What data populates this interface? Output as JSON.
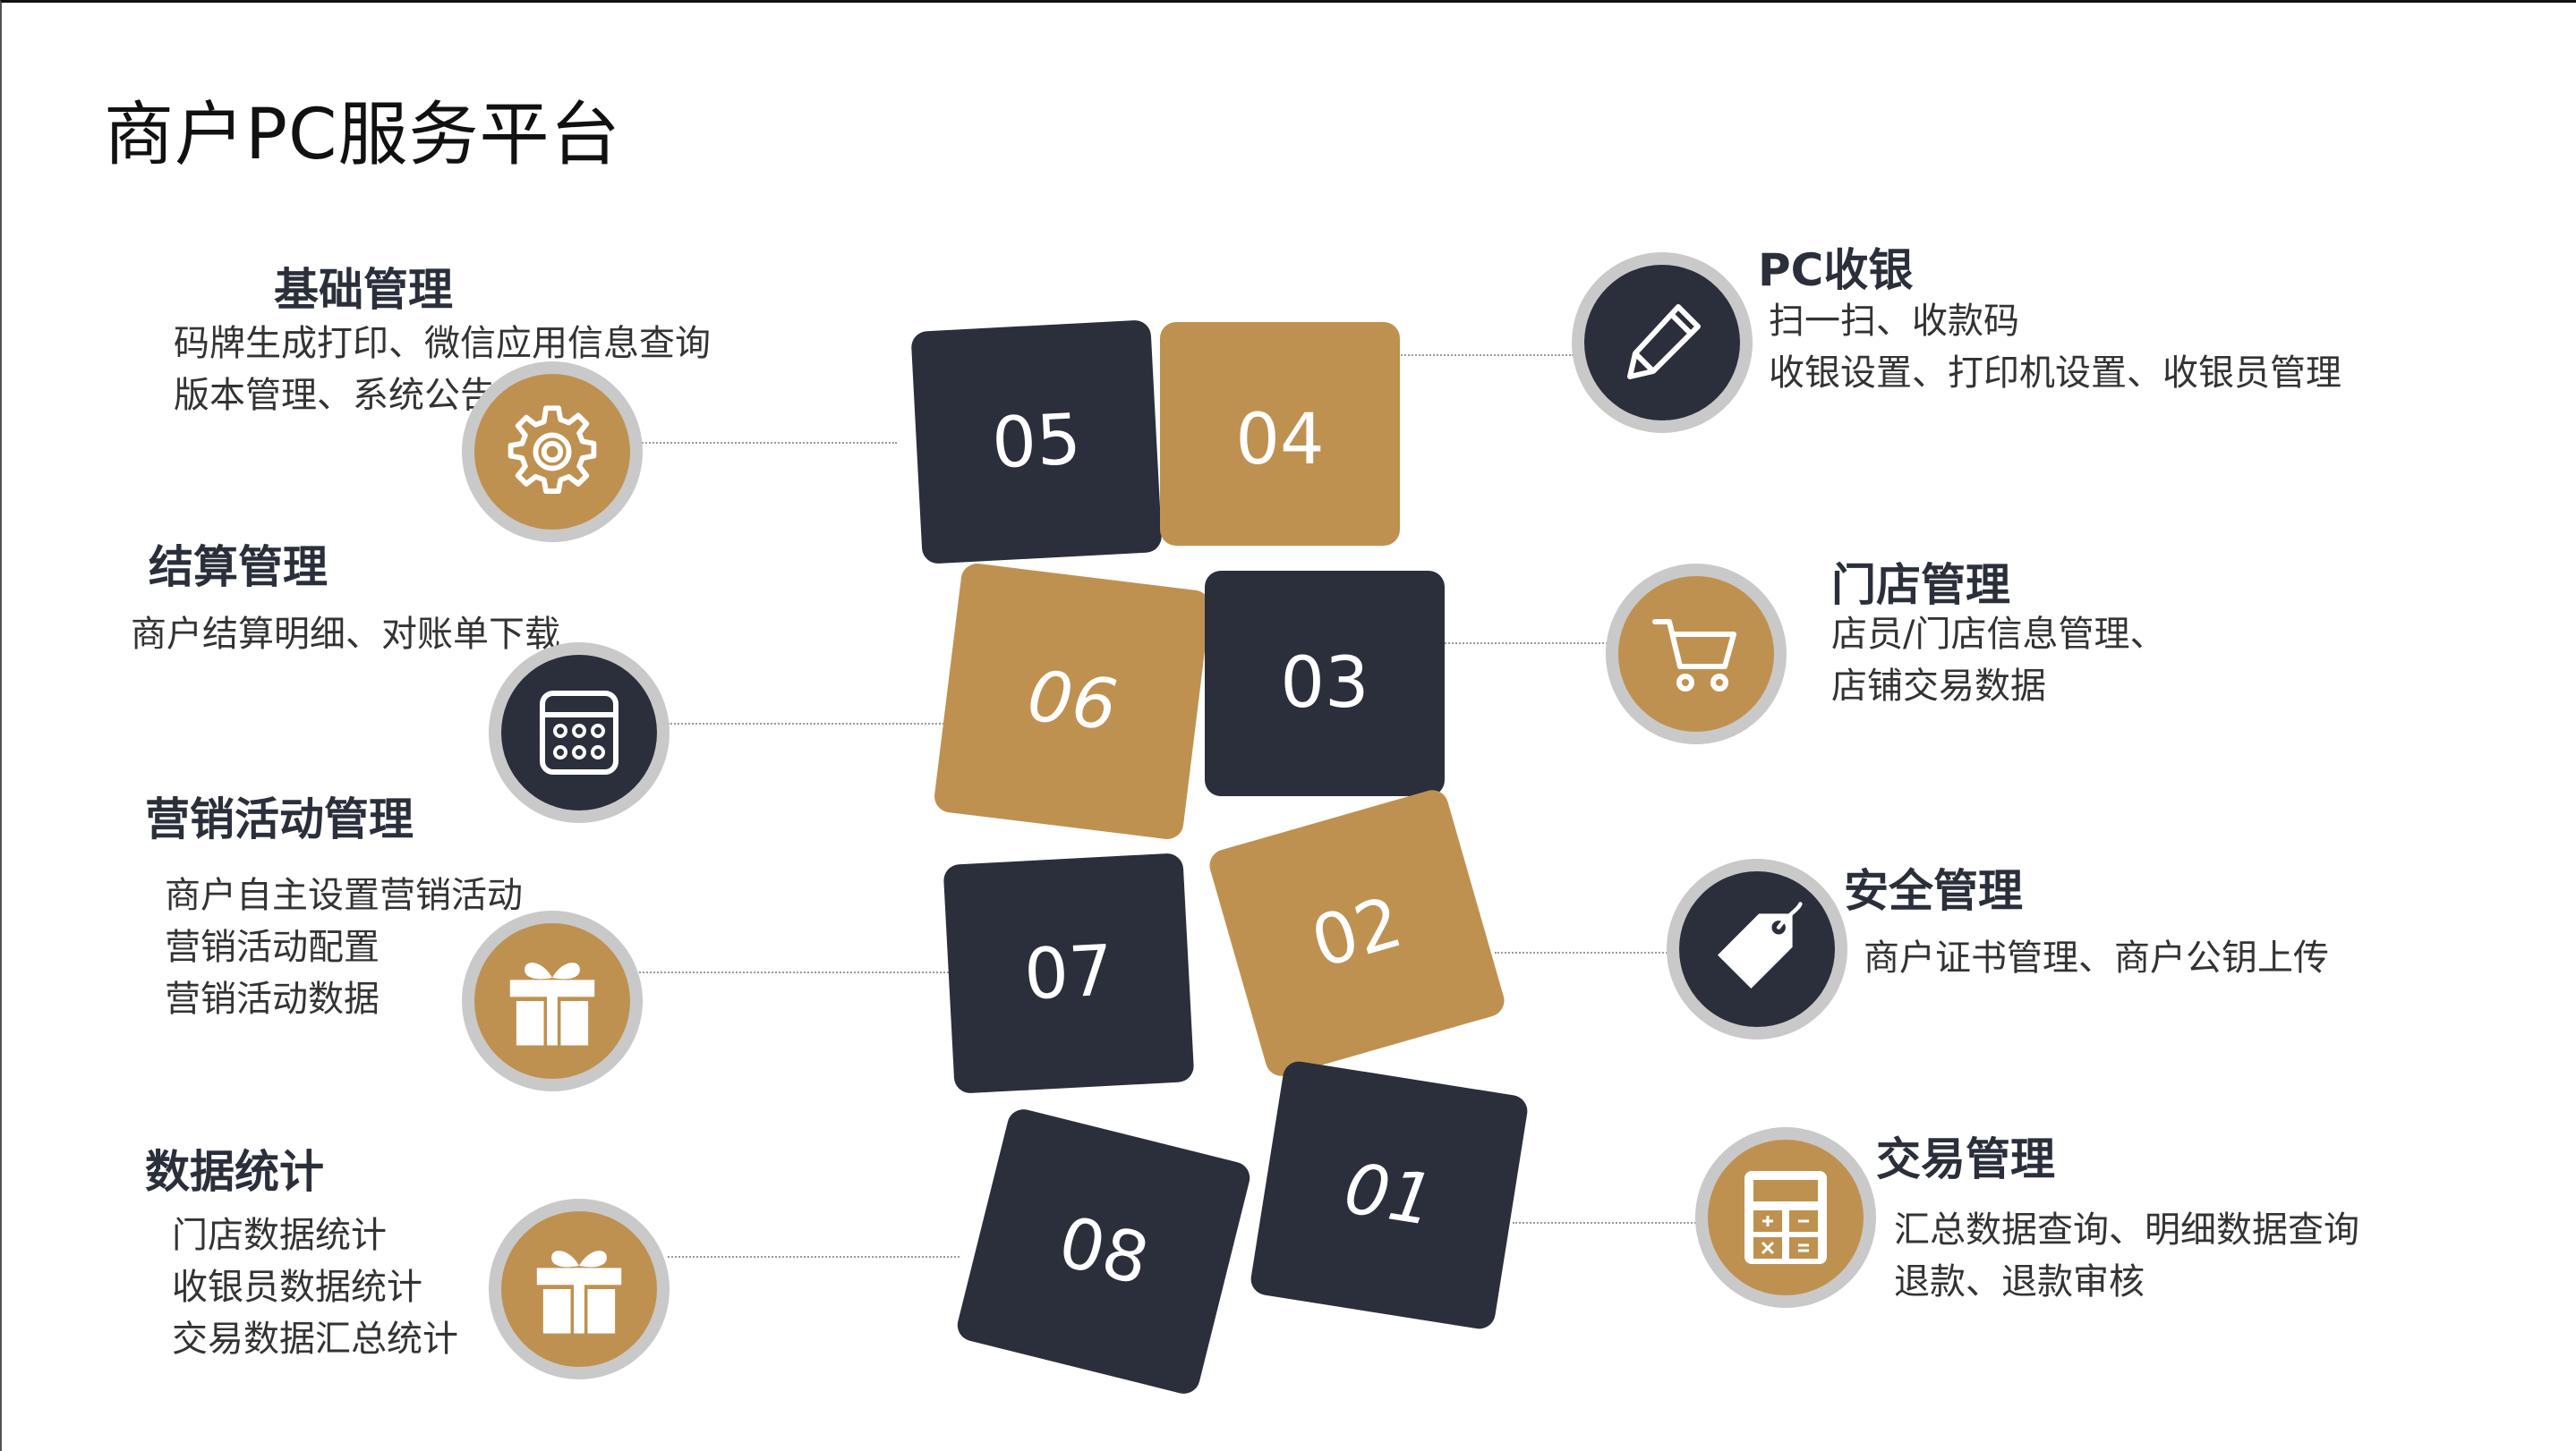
{
  "title": "商户PC服务平台",
  "colors": {
    "gold": "#bf9150",
    "navy": "#2a2f3b",
    "ring": "#c9c9c9"
  },
  "tiles": [
    "01",
    "02",
    "03",
    "04",
    "05",
    "06",
    "07",
    "08"
  ],
  "sections": {
    "jichu": {
      "heading": "基础管理",
      "lines": [
        "码牌生成打印、微信应用信息查询",
        "版本管理、系统公告"
      ],
      "icon": "gear-icon"
    },
    "jiesuan": {
      "heading": "结算管理",
      "lines": [
        "商户结算明细、对账单下载"
      ],
      "icon": "calculator-icon"
    },
    "yingxiao": {
      "heading": "营销活动管理",
      "lines": [
        "商户自主设置营销活动",
        "营销活动配置",
        "营销活动数据"
      ],
      "icon": "gift-icon"
    },
    "shuju": {
      "heading": "数据统计",
      "lines": [
        "门店数据统计",
        "收银员数据统计",
        "交易数据汇总统计"
      ],
      "icon": "gift-icon"
    },
    "pc": {
      "heading": "PC收银",
      "lines": [
        "扫一扫、收款码",
        "收银设置、打印机设置、收银员管理"
      ],
      "icon": "pencil-icon"
    },
    "mendian": {
      "heading": "门店管理",
      "lines": [
        "店员/门店信息管理、",
        "店铺交易数据"
      ],
      "icon": "cart-icon"
    },
    "anquan": {
      "heading": "安全管理",
      "lines": [
        "商户证书管理、商户公钥上传"
      ],
      "icon": "tag-icon"
    },
    "jiaoyi": {
      "heading": "交易管理",
      "lines": [
        "汇总数据查询、明细数据查询",
        "退款、退款审核"
      ],
      "icon": "calculator-icon"
    }
  }
}
